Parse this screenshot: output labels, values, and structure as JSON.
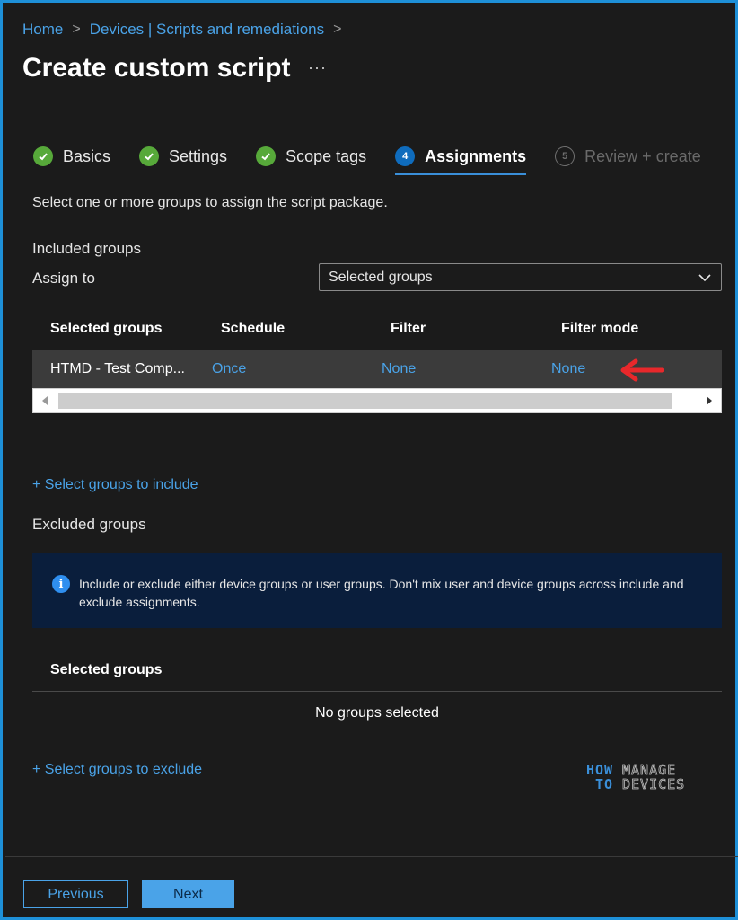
{
  "breadcrumb": {
    "items": [
      "Home",
      "Devices | Scripts and remediations"
    ],
    "separator": ">"
  },
  "page": {
    "title": "Create custom script",
    "more": "···"
  },
  "wizard": {
    "steps": [
      {
        "label": "Basics",
        "state": "complete"
      },
      {
        "label": "Settings",
        "state": "complete"
      },
      {
        "label": "Scope tags",
        "state": "complete"
      },
      {
        "label": "Assignments",
        "number": "4",
        "state": "active"
      },
      {
        "label": "Review + create",
        "number": "5",
        "state": "disabled"
      }
    ]
  },
  "assignments": {
    "description": "Select one or more groups to assign the script package.",
    "included_label": "Included groups",
    "assign_to_label": "Assign to",
    "assign_to_value": "Selected groups",
    "table": {
      "headers": [
        "Selected groups",
        "Schedule",
        "Filter",
        "Filter mode"
      ],
      "rows": [
        [
          "HTMD - Test Comp...",
          "Once",
          "None",
          "None"
        ]
      ]
    },
    "include_link": "+ Select groups to include",
    "excluded_label": "Excluded groups",
    "info_text": "Include or exclude either device groups or user groups. Don't mix user and device groups across include and exclude assignments.",
    "excluded_table_header": "Selected groups",
    "no_groups": "No groups selected",
    "exclude_link": "+ Select groups to exclude"
  },
  "logo": {
    "how": "HOW",
    "to": "TO",
    "manage": "MANAGE",
    "devices": "DEVICES"
  },
  "footer": {
    "previous": "Previous",
    "next": "Next"
  },
  "colors": {
    "accent": "#4aa3e8",
    "success": "#57a93a",
    "annotation_arrow": "#e8282b",
    "info_bg": "#0a1e3c"
  }
}
